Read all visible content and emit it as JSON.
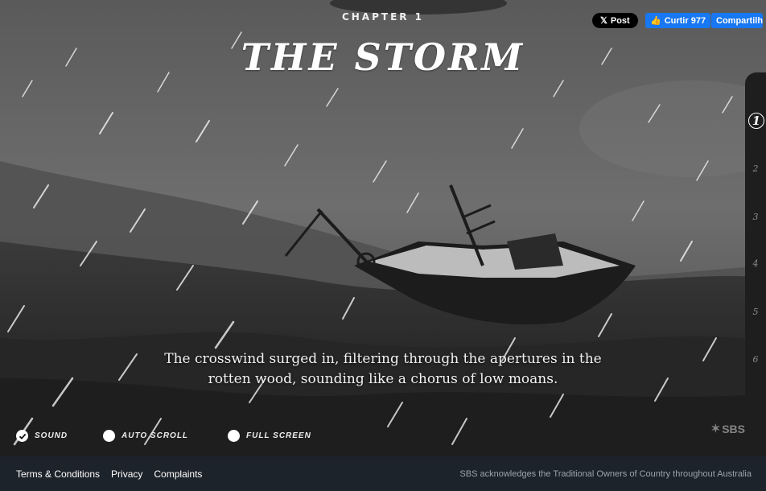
{
  "chapter": {
    "label": "CHAPTER 1",
    "title": "THE STORM"
  },
  "social": {
    "x_post": "Post",
    "fb_like": "Curtir 977",
    "fb_share": "Compartilhar"
  },
  "chapter_nav": {
    "items": [
      "1",
      "2",
      "3",
      "4",
      "5",
      "6"
    ],
    "active": "1"
  },
  "narration": "The crosswind surged in, filtering through the apertures in the rotten wood, sounding like a chorus of low moans.",
  "controls": {
    "sound": {
      "label": "SOUND",
      "checked": true
    },
    "auto_scroll": {
      "label": "AUTO SCROLL",
      "checked": false
    },
    "full_screen": {
      "label": "FULL SCREEN",
      "checked": false
    }
  },
  "watermark": "SBS",
  "footer": {
    "links": [
      "Terms & Conditions",
      "Privacy",
      "Complaints"
    ],
    "acknowledgement": "SBS acknowledges the Traditional Owners of Country throughout Australia"
  }
}
